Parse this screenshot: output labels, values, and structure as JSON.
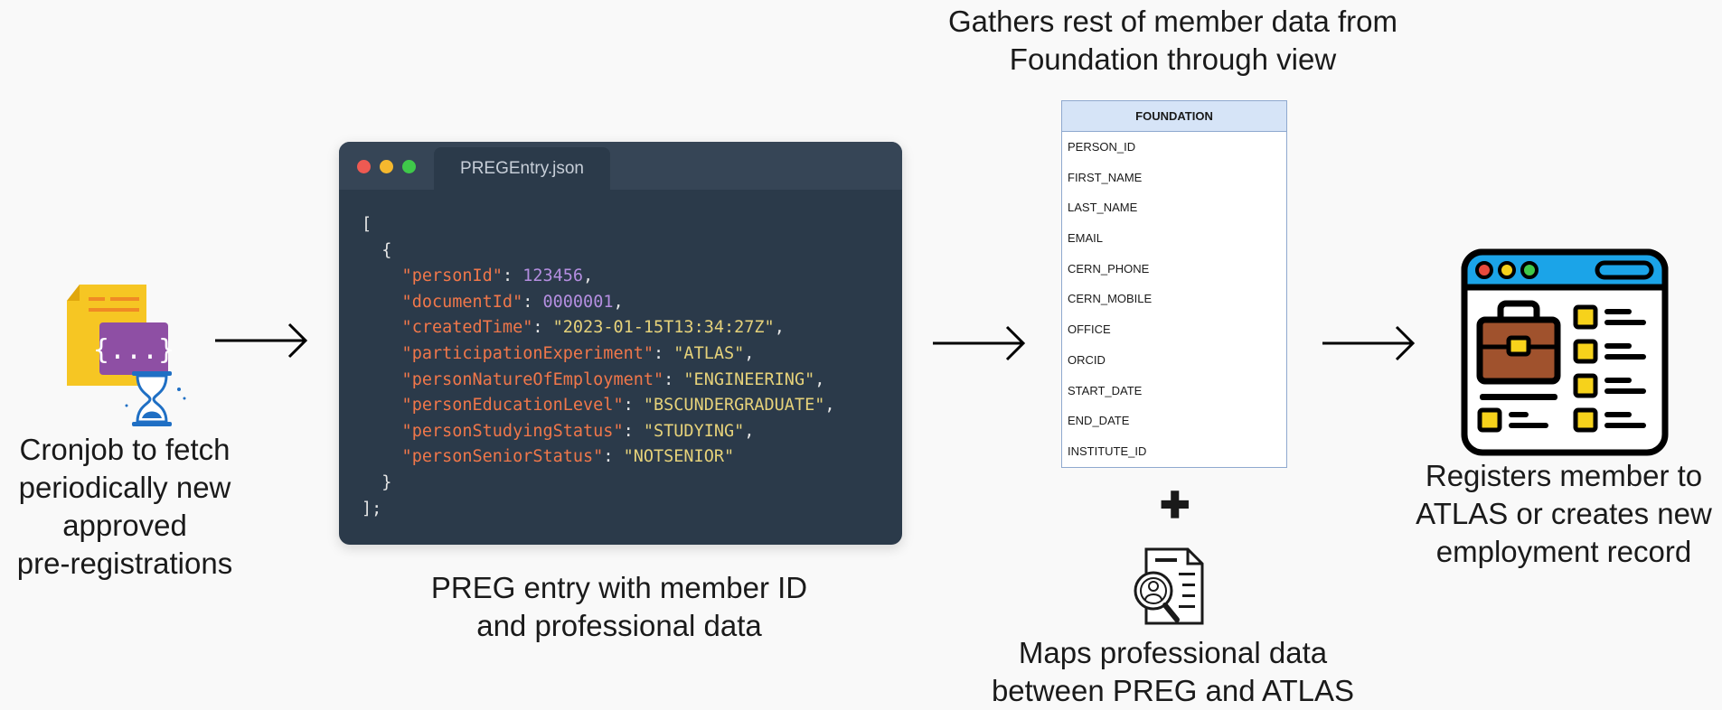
{
  "captions": {
    "cronjob": "Cronjob to fetch\nperiodically new\napproved\npre-registrations",
    "preg_entry": "PREG entry with member ID\nand professional data",
    "gathers": "Gathers rest of member data from\nFoundation through view",
    "maps": "Maps professional data\nbetween PREG and ATLAS",
    "registers": "Registers member to\nATLAS or creates new\nemployment record"
  },
  "code_window": {
    "filename": "PREGEntry.json",
    "dot_colors": [
      "#ee5a52",
      "#f5b82e",
      "#3fc94a"
    ],
    "lines": [
      [
        {
          "t": "p",
          "v": "["
        }
      ],
      [
        {
          "t": "p",
          "v": "  {"
        }
      ],
      [
        {
          "t": "k",
          "v": "    \"personId\""
        },
        {
          "t": "p",
          "v": ": "
        },
        {
          "t": "n",
          "v": "123456"
        },
        {
          "t": "p",
          "v": ","
        }
      ],
      [
        {
          "t": "k",
          "v": "    \"documentId\""
        },
        {
          "t": "p",
          "v": ": "
        },
        {
          "t": "n",
          "v": "0000001"
        },
        {
          "t": "p",
          "v": ","
        }
      ],
      [
        {
          "t": "k",
          "v": "    \"createdTime\""
        },
        {
          "t": "p",
          "v": ": "
        },
        {
          "t": "s",
          "v": "\"2023-01-15T13:34:27Z\""
        },
        {
          "t": "p",
          "v": ","
        }
      ],
      [
        {
          "t": "k",
          "v": "    \"participationExperiment\""
        },
        {
          "t": "p",
          "v": ": "
        },
        {
          "t": "s",
          "v": "\"ATLAS\""
        },
        {
          "t": "p",
          "v": ","
        }
      ],
      [
        {
          "t": "k",
          "v": "    \"personNatureOfEmployment\""
        },
        {
          "t": "p",
          "v": ": "
        },
        {
          "t": "s",
          "v": "\"ENGINEERING\""
        },
        {
          "t": "p",
          "v": ","
        }
      ],
      [
        {
          "t": "k",
          "v": "    \"personEducationLevel\""
        },
        {
          "t": "p",
          "v": ": "
        },
        {
          "t": "s",
          "v": "\"BSCUNDERGRADUATE\""
        },
        {
          "t": "p",
          "v": ","
        }
      ],
      [
        {
          "t": "k",
          "v": "    \"personStudyingStatus\""
        },
        {
          "t": "p",
          "v": ": "
        },
        {
          "t": "s",
          "v": "\"STUDYING\""
        },
        {
          "t": "p",
          "v": ","
        }
      ],
      [
        {
          "t": "k",
          "v": "    \"personSeniorStatus\""
        },
        {
          "t": "p",
          "v": ": "
        },
        {
          "t": "s",
          "v": "\"NOTSENIOR\""
        }
      ],
      [
        {
          "t": "p",
          "v": "  }"
        }
      ],
      [
        {
          "t": "p",
          "v": "];"
        }
      ]
    ]
  },
  "foundation_table": {
    "title": "FOUNDATION",
    "fields": [
      "PERSON_ID",
      "FIRST_NAME",
      "LAST_NAME",
      "EMAIL",
      "CERN_PHONE",
      "CERN_MOBILE",
      "OFFICE",
      "ORCID",
      "START_DATE",
      "END_DATE",
      "INSTITUTE_ID"
    ]
  },
  "plus_symbol": "✚",
  "icons": {
    "cron": "json-file-hourglass-icon",
    "arrows": "right-arrow-icon",
    "document": "document-search-person-icon",
    "browser": "browser-form-briefcase-icon"
  },
  "colors": {
    "background": "#f9f9f9",
    "code_bg": "#2b3a4a",
    "code_key": "#f0774a",
    "code_number": "#b48ee0",
    "code_string": "#e6d27a",
    "table_header": "#d6e4f7",
    "browser_bar": "#1ba4e8",
    "yellow": "#f6d21b",
    "briefcase": "#a0522d"
  }
}
